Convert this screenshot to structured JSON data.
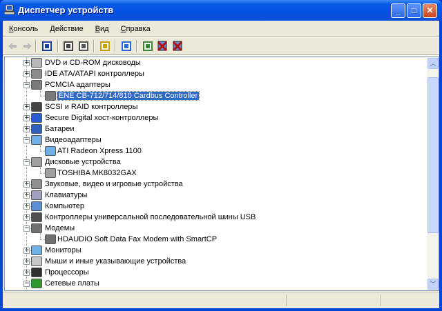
{
  "window": {
    "title": "Диспетчер устройств",
    "buttons": [
      "minimize",
      "maximize",
      "close"
    ]
  },
  "menu": [
    {
      "label": "Консоль",
      "accel": "К"
    },
    {
      "label": "Действие",
      "accel": "Д"
    },
    {
      "label": "Вид",
      "accel": "В"
    },
    {
      "label": "Справка",
      "accel": "С"
    }
  ],
  "toolbar": [
    "back-icon",
    "forward-icon",
    "show-hide-tree-icon",
    "properties-icon",
    "print-icon",
    "help-icon",
    "scan-hardware-icon",
    "update-driver-icon",
    "uninstall-icon",
    "disable-icon"
  ],
  "tree": [
    {
      "label": "DVD и CD-ROM дисководы",
      "level": 0,
      "state": "collapsed",
      "icon": "cdrom-icon",
      "color": "#b8b8b8"
    },
    {
      "label": "IDE ATA/ATAPI контроллеры",
      "level": 0,
      "state": "collapsed",
      "icon": "ide-controller-icon",
      "color": "#8c8c8c"
    },
    {
      "label": "PCMCIA адаптеры",
      "level": 0,
      "state": "expanded",
      "icon": "pcmcia-icon",
      "color": "#7a7a7a"
    },
    {
      "label": "ENE CB-712/714/810 Cardbus Controller",
      "level": 1,
      "selected": true,
      "icon": "pcmcia-card-icon",
      "color": "#7a7a7a"
    },
    {
      "label": "SCSI и RAID контроллеры",
      "level": 0,
      "state": "collapsed",
      "icon": "scsi-icon",
      "color": "#444444"
    },
    {
      "label": "Secure Digital хост-контроллеры",
      "level": 0,
      "state": "collapsed",
      "icon": "sd-host-icon",
      "color": "#2a5bd0"
    },
    {
      "label": "Батареи",
      "level": 0,
      "state": "collapsed",
      "icon": "battery-icon",
      "color": "#3060c0"
    },
    {
      "label": "Видеоадаптеры",
      "level": 0,
      "state": "expanded",
      "icon": "display-adapter-icon",
      "color": "#6fb0e8"
    },
    {
      "label": "ATI Radeon Xpress 1100",
      "level": 1,
      "icon": "monitor-icon",
      "color": "#6fb0e8"
    },
    {
      "label": "Дисковые устройства",
      "level": 0,
      "state": "expanded",
      "icon": "disk-drive-icon",
      "color": "#a0a0a0"
    },
    {
      "label": "TOSHIBA MK8032GAX",
      "level": 1,
      "icon": "hard-disk-icon",
      "color": "#a0a0a0"
    },
    {
      "label": "Звуковые, видео и игровые устройства",
      "level": 0,
      "state": "collapsed",
      "icon": "sound-icon",
      "color": "#909090"
    },
    {
      "label": "Клавиатуры",
      "level": 0,
      "state": "collapsed",
      "icon": "keyboard-icon",
      "color": "#a0a0c0"
    },
    {
      "label": "Компьютер",
      "level": 0,
      "state": "collapsed",
      "icon": "computer-icon",
      "color": "#5a8fd8"
    },
    {
      "label": "Контроллеры универсальной последовательной шины USB",
      "level": 0,
      "state": "collapsed",
      "icon": "usb-icon",
      "color": "#505050"
    },
    {
      "label": "Модемы",
      "level": 0,
      "state": "expanded",
      "icon": "modem-icon",
      "color": "#707070"
    },
    {
      "label": "HDAUDIO Soft Data Fax Modem with SmartCP",
      "level": 1,
      "icon": "modem-device-icon",
      "color": "#707070"
    },
    {
      "label": "Мониторы",
      "level": 0,
      "state": "collapsed",
      "icon": "monitors-icon",
      "color": "#6fb0e8"
    },
    {
      "label": "Мыши и иные указывающие устройства",
      "level": 0,
      "state": "collapsed",
      "icon": "mouse-icon",
      "color": "#c8c8c8"
    },
    {
      "label": "Процессоры",
      "level": 0,
      "state": "collapsed",
      "icon": "processor-icon",
      "color": "#303030"
    },
    {
      "label": "Сетевые платы",
      "level": 0,
      "state": "expanded",
      "icon": "network-card-icon",
      "color": "#2e9a2e"
    }
  ],
  "scrollbar": {
    "position_fraction": 0.1
  }
}
